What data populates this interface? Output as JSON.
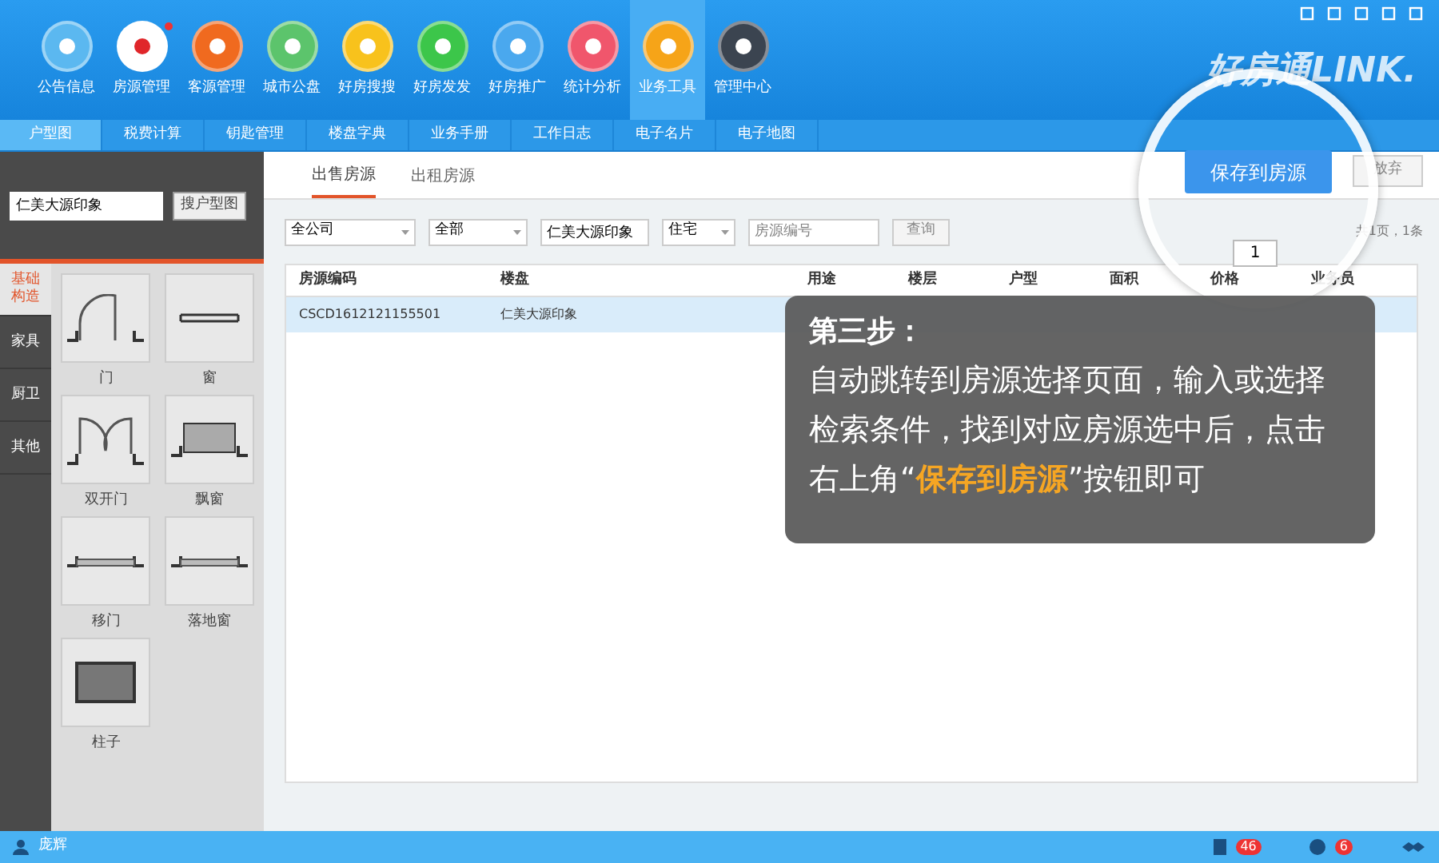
{
  "nav": [
    {
      "label": "公告信息",
      "color": "#5bb8f0",
      "selected": false,
      "badge": false
    },
    {
      "label": "房源管理",
      "color": "#ffffff",
      "selected": false,
      "badge": true
    },
    {
      "label": "客源管理",
      "color": "#f06a1f",
      "selected": false,
      "badge": false
    },
    {
      "label": "城市公盘",
      "color": "#5cc46c",
      "selected": false,
      "badge": false
    },
    {
      "label": "好房搜搜",
      "color": "#f8c21c",
      "selected": false,
      "badge": false
    },
    {
      "label": "好房发发",
      "color": "#3cc64a",
      "selected": false,
      "badge": false
    },
    {
      "label": "好房推广",
      "color": "#4aa8ee",
      "selected": false,
      "badge": false
    },
    {
      "label": "统计分析",
      "color": "#f0566c",
      "selected": false,
      "badge": false
    },
    {
      "label": "业务工具",
      "color": "#f6a418",
      "selected": true,
      "badge": false
    },
    {
      "label": "管理中心",
      "color": "#3b4450",
      "selected": false,
      "badge": false
    }
  ],
  "logo": "好房通LINK.",
  "subtabs": [
    {
      "label": "户型图",
      "selected": true
    },
    {
      "label": "税费计算",
      "selected": false
    },
    {
      "label": "钥匙管理",
      "selected": false
    },
    {
      "label": "楼盘字典",
      "selected": false
    },
    {
      "label": "业务手册",
      "selected": false
    },
    {
      "label": "工作日志",
      "selected": false
    },
    {
      "label": "电子名片",
      "selected": false
    },
    {
      "label": "电子地图",
      "selected": false
    }
  ],
  "left": {
    "search_value": "仁美大源印象",
    "search_button": "搜户型图",
    "categories": [
      {
        "label": "基础构造",
        "selected": true
      },
      {
        "label": "家具",
        "selected": false
      },
      {
        "label": "厨卫",
        "selected": false
      },
      {
        "label": "其他",
        "selected": false
      }
    ],
    "shapes": [
      {
        "label": "门",
        "kind": "door"
      },
      {
        "label": "窗",
        "kind": "window"
      },
      {
        "label": "双开门",
        "kind": "double-door"
      },
      {
        "label": "飘窗",
        "kind": "bay-window"
      },
      {
        "label": "移门",
        "kind": "sliding-door"
      },
      {
        "label": "落地窗",
        "kind": "french-window"
      },
      {
        "label": "柱子",
        "kind": "pillar"
      }
    ]
  },
  "main": {
    "tabs": [
      {
        "label": "出售房源",
        "selected": true
      },
      {
        "label": "出租房源",
        "selected": false
      }
    ],
    "save_button": "保存到房源",
    "discard_button": "放弃",
    "filters": [
      {
        "kind": "select",
        "value": "全公司"
      },
      {
        "kind": "select",
        "value": "全部"
      },
      {
        "kind": "input",
        "value": "仁美大源印象"
      },
      {
        "kind": "select",
        "value": "住宅"
      },
      {
        "kind": "input",
        "placeholder": "房源编号"
      }
    ],
    "query_button": "查询",
    "page_number": "1",
    "page_info": "共1页，1条",
    "table": {
      "columns": [
        "房源编码",
        "楼盘",
        "用途",
        "楼层",
        "户型",
        "面积",
        "价格",
        "业务员"
      ],
      "rows": [
        {
          "cells": [
            "CSCD1612121155501",
            "仁美大源印象"
          ],
          "selected": true
        }
      ]
    }
  },
  "callout": {
    "title": "第三步：",
    "body": [
      {
        "text": "自动跳转到房源选择页面，输入或选择检索条件，找到对应房源选中后，点击右上角“",
        "highlight": false
      },
      {
        "text": "保存到房源",
        "highlight": true
      },
      {
        "text": "”按钮即可",
        "highlight": false
      }
    ]
  },
  "status_bar": {
    "user": "庞辉",
    "docs_count": "46",
    "info_count": "6"
  }
}
